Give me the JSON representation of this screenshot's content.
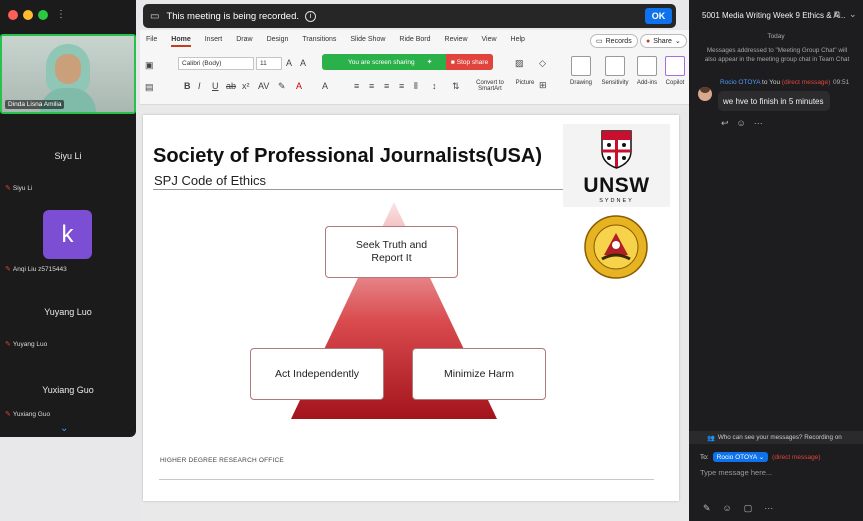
{
  "recording_bar": {
    "message": "This meeting is being recorded.",
    "ok_label": "OK"
  },
  "participants": {
    "active_speaker": "Dinda Lisna Amilia",
    "tiles": [
      {
        "center_name": "Siyu Li",
        "tag": "Siyu Li"
      },
      {
        "avatar_letter": "k",
        "tag": "Anqi Liu z5715443"
      },
      {
        "center_name": "Yuyang Luo",
        "tag": "Yuyang Luo"
      },
      {
        "center_name": "Yuxiang Guo",
        "tag": "Yuxiang Guo"
      }
    ]
  },
  "ribbon": {
    "tabs": [
      "File",
      "Home",
      "Insert",
      "Draw",
      "Design",
      "Transitions",
      "Slide Show",
      "Ride Bord",
      "Review",
      "View",
      "Help"
    ],
    "active_tab": "Home",
    "records_label": "Records",
    "share_label": "Share",
    "font_name": "Calibri (Body)",
    "font_size": "11",
    "sharing_text": "You are screen sharing",
    "stop_share_label": "Stop share",
    "convert_label_1": "Convert to",
    "convert_label_2": "SmartArt",
    "picture_label": "Picture",
    "drawing_label": "Drawing",
    "sensitivity_label": "Sensitivity",
    "addins_label": "Add-ins",
    "copilot_label": "Copilot"
  },
  "slide": {
    "title": "Society of Professional Journalists(USA)",
    "subtitle": "SPJ Code of Ethics",
    "logo_word": "UNSW",
    "logo_sub": "SYDNEY",
    "pyramid_top_1": "Seek Truth and",
    "pyramid_top_2": "Report It",
    "pyramid_left": "Act Independently",
    "pyramid_right": "Minimize Harm",
    "footer": "HIGHER DEGREE RESEARCH OFFICE"
  },
  "chat": {
    "title": "5001 Media Writing Week 9 Ethics & A...",
    "date_divider": "Today",
    "system_message": "Messages addressed to \"Meeting Group Chat\" will also appear in the meeting group chat in Team Chat",
    "messages": [
      {
        "sender": "Rocio OTOYA",
        "to_text": "to You",
        "dm_tag": "(direct message)",
        "time": "09:51",
        "text": "we hve to finish in 5 minutes"
      }
    ],
    "who_can_see": "Who can see your messages? Recording on",
    "to_label": "To:",
    "recipient": "Rocio OTOYA",
    "recipient_tag": "(direct message)",
    "input_placeholder": "Type message here..."
  },
  "colors": {
    "accent_blue": "#0e72ed",
    "speaker_border": "#27c24c",
    "sharing_green": "#2bb14a",
    "stop_red": "#e0443c",
    "pyramid_red": "#b01e26",
    "ppt_accent": "#c43e1c"
  }
}
